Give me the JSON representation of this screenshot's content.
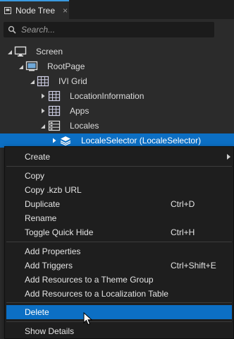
{
  "tab": {
    "title": "Node Tree",
    "close": "×",
    "pin_icon": "pin-icon"
  },
  "search": {
    "placeholder": "Search..."
  },
  "tree": [
    {
      "label": "Screen",
      "icon": "monitor-icon"
    },
    {
      "label": "RootPage",
      "icon": "page-icon"
    },
    {
      "label": "IVI Grid",
      "icon": "grid-icon"
    },
    {
      "label": "LocationInformation",
      "icon": "grid-icon"
    },
    {
      "label": "Apps",
      "icon": "grid-icon"
    },
    {
      "label": "Locales",
      "icon": "stack-panel-icon"
    },
    {
      "label": "LocaleSelector (LocaleSelector)",
      "icon": "layers-icon",
      "selected": true
    }
  ],
  "menu": {
    "create": "Create",
    "copy": "Copy",
    "copy_kzb_url": "Copy .kzb URL",
    "duplicate": "Duplicate",
    "duplicate_shortcut": "Ctrl+D",
    "rename": "Rename",
    "toggle_quick_hide": "Toggle Quick Hide",
    "toggle_quick_hide_shortcut": "Ctrl+H",
    "add_properties": "Add Properties",
    "add_triggers": "Add Triggers",
    "add_triggers_shortcut": "Ctrl+Shift+E",
    "add_resources_theme": "Add Resources to a Theme Group",
    "add_resources_localization": "Add Resources to a Localization Table",
    "delete": "Delete",
    "show_details": "Show Details"
  },
  "colors": {
    "accent": "#0c6fc4",
    "background": "#2b2b2b",
    "menu_background": "#1e1e1e"
  }
}
